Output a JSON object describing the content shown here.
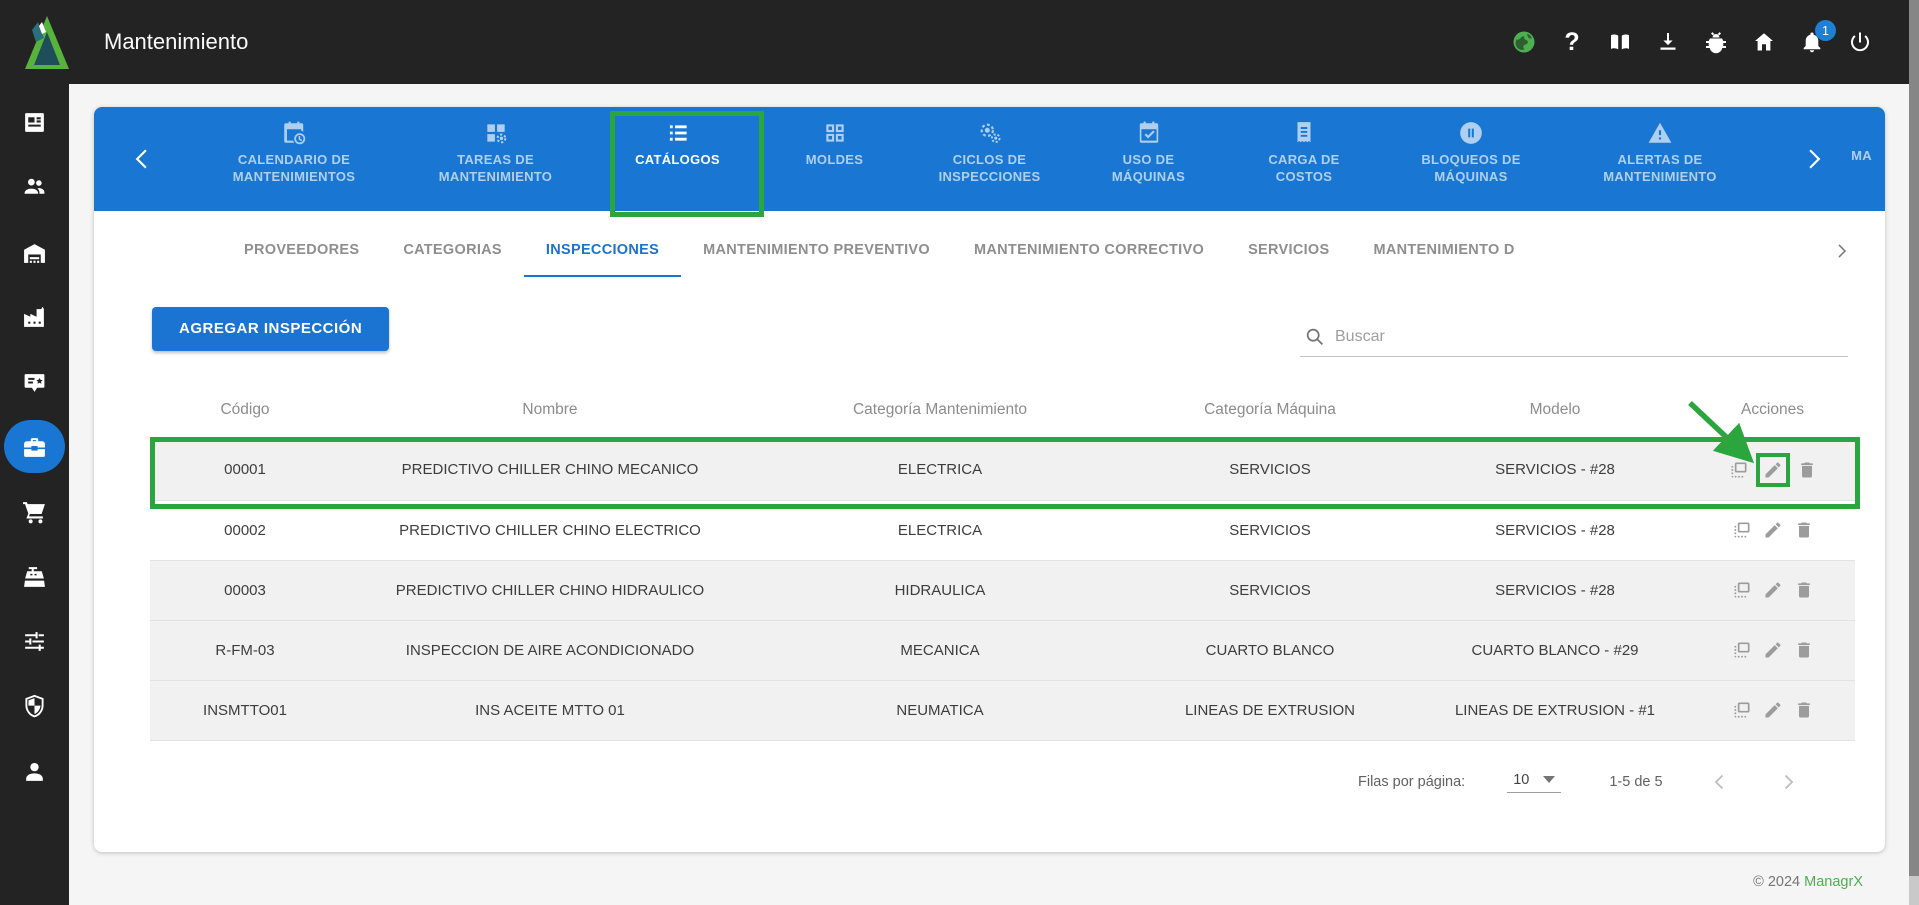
{
  "app": {
    "title": "Mantenimiento"
  },
  "topbar": {
    "notification_count": "1",
    "icons": [
      "globe-language-icon",
      "help-icon",
      "book-docs-icon",
      "download-icon",
      "bug-report-icon",
      "home-icon",
      "notifications-bell-icon",
      "power-icon"
    ]
  },
  "sidebar": {
    "items": [
      "news-dashboard",
      "users",
      "warehouse",
      "factory",
      "certificate",
      "toolbox-maintenance",
      "shopping-cart",
      "cash-register",
      "tune-sliders",
      "shield-security",
      "user-profile"
    ],
    "active_item": "toolbox-maintenance"
  },
  "nav_tabs": {
    "tabs": [
      {
        "label": "CALENDARIO DE MANTENIMIENTOS"
      },
      {
        "label": "TAREAS DE MANTENIMIENTO"
      },
      {
        "label": "CATÁLOGOS"
      },
      {
        "label": "MOLDES"
      },
      {
        "label": "CICLOS DE INSPECCIONES"
      },
      {
        "label": "USO DE MÁQUINAS"
      },
      {
        "label": "CARGA DE COSTOS"
      },
      {
        "label": "BLOQUEOS DE MÁQUINAS"
      },
      {
        "label": "ALERTAS DE MANTENIMIENTO"
      },
      {
        "label": "MA"
      }
    ],
    "active": "CATÁLOGOS"
  },
  "subtabs": {
    "tabs": [
      "PROVEEDORES",
      "CATEGORIAS",
      "INSPECCIONES",
      "MANTENIMIENTO PREVENTIVO",
      "MANTENIMIENTO CORRECTIVO",
      "SERVICIOS",
      "MANTENIMIENTO D"
    ],
    "active": "INSPECCIONES"
  },
  "toolbar": {
    "add_button_label": "AGREGAR INSPECCIÓN",
    "search_placeholder": "Buscar"
  },
  "table": {
    "columns": [
      "Código",
      "Nombre",
      "Categoría Mantenimiento",
      "Categoría Máquina",
      "Modelo",
      "Acciones"
    ],
    "rows": [
      {
        "codigo": "00001",
        "nombre": "PREDICTIVO CHILLER CHINO MECANICO",
        "categoria_mantenimiento": "ELECTRICA",
        "categoria_maquina": "SERVICIOS",
        "modelo": "SERVICIOS - #28",
        "shaded": true,
        "highlighted": true
      },
      {
        "codigo": "00002",
        "nombre": "PREDICTIVO CHILLER CHINO ELECTRICO",
        "categoria_mantenimiento": "ELECTRICA",
        "categoria_maquina": "SERVICIOS",
        "modelo": "SERVICIOS - #28",
        "shaded": false,
        "highlighted": false
      },
      {
        "codigo": "00003",
        "nombre": "PREDICTIVO CHILLER CHINO HIDRAULICO",
        "categoria_mantenimiento": "HIDRAULICA",
        "categoria_maquina": "SERVICIOS",
        "modelo": "SERVICIOS - #28",
        "shaded": true,
        "highlighted": false
      },
      {
        "codigo": "R-FM-03",
        "nombre": "INSPECCION DE AIRE ACONDICIONADO",
        "categoria_mantenimiento": "MECANICA",
        "categoria_maquina": "CUARTO BLANCO",
        "modelo": "CUARTO BLANCO - #29",
        "shaded": true,
        "highlighted": false
      },
      {
        "codigo": "INSMTTO01",
        "nombre": "INS ACEITE MTTO 01",
        "categoria_mantenimiento": "NEUMATICA",
        "categoria_maquina": "LINEAS DE EXTRUSION",
        "modelo": "LINEAS DE EXTRUSION - #1",
        "shaded": true,
        "highlighted": false
      }
    ]
  },
  "pagination": {
    "rows_per_page_label": "Filas por página:",
    "rows_per_page_value": "10",
    "range_text": "1-5 de 5"
  },
  "footer": {
    "copyright": "© 2024",
    "brand": "ManagrX"
  },
  "colors": {
    "accent_blue": "#1976d2",
    "topbar_bg": "#232323",
    "annotation_green": "#2ba63e",
    "brand_green": "#4caf50",
    "badge_blue": "#1e7fd6",
    "row_shade": "#f1f1f1"
  }
}
